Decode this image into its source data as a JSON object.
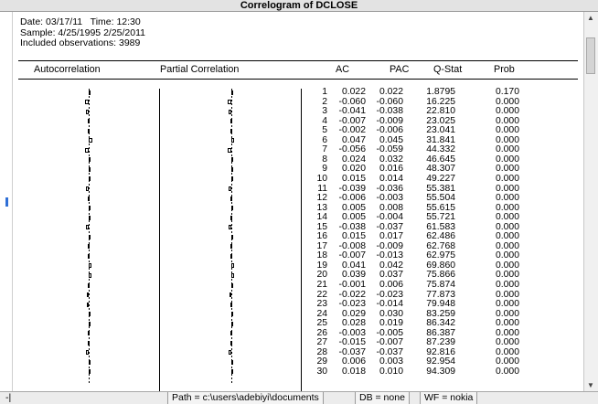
{
  "window": {
    "title": "Correlogram of DCLOSE"
  },
  "info": {
    "date_line": "Date: 03/17/11   Time: 12:30",
    "sample_line": "Sample: 4/25/1995 2/25/2011",
    "obs_line": "Included observations: 3989"
  },
  "headers": {
    "autocorrelation": "Autocorrelation",
    "partial_correlation": "Partial Correlation",
    "ac": "AC",
    "pac": "PAC",
    "qstat": "Q-Stat",
    "prob": "Prob"
  },
  "rows": [
    {
      "lag": "1",
      "ac": "0.022",
      "pac": "0.022",
      "q": "1.8795",
      "prob": "0.170"
    },
    {
      "lag": "2",
      "ac": "-0.060",
      "pac": "-0.060",
      "q": "16.225",
      "prob": "0.000"
    },
    {
      "lag": "3",
      "ac": "-0.041",
      "pac": "-0.038",
      "q": "22.810",
      "prob": "0.000"
    },
    {
      "lag": "4",
      "ac": "-0.007",
      "pac": "-0.009",
      "q": "23.025",
      "prob": "0.000"
    },
    {
      "lag": "5",
      "ac": "-0.002",
      "pac": "-0.006",
      "q": "23.041",
      "prob": "0.000"
    },
    {
      "lag": "6",
      "ac": "0.047",
      "pac": "0.045",
      "q": "31.841",
      "prob": "0.000"
    },
    {
      "lag": "7",
      "ac": "-0.056",
      "pac": "-0.059",
      "q": "44.332",
      "prob": "0.000"
    },
    {
      "lag": "8",
      "ac": "0.024",
      "pac": "0.032",
      "q": "46.645",
      "prob": "0.000"
    },
    {
      "lag": "9",
      "ac": "0.020",
      "pac": "0.016",
      "q": "48.307",
      "prob": "0.000"
    },
    {
      "lag": "10",
      "ac": "0.015",
      "pac": "0.014",
      "q": "49.227",
      "prob": "0.000"
    },
    {
      "lag": "11",
      "ac": "-0.039",
      "pac": "-0.036",
      "q": "55.381",
      "prob": "0.000"
    },
    {
      "lag": "12",
      "ac": "-0.006",
      "pac": "-0.003",
      "q": "55.504",
      "prob": "0.000"
    },
    {
      "lag": "13",
      "ac": "0.005",
      "pac": "0.008",
      "q": "55.615",
      "prob": "0.000"
    },
    {
      "lag": "14",
      "ac": "0.005",
      "pac": "-0.004",
      "q": "55.721",
      "prob": "0.000"
    },
    {
      "lag": "15",
      "ac": "-0.038",
      "pac": "-0.037",
      "q": "61.583",
      "prob": "0.000"
    },
    {
      "lag": "16",
      "ac": "0.015",
      "pac": "0.017",
      "q": "62.486",
      "prob": "0.000"
    },
    {
      "lag": "17",
      "ac": "-0.008",
      "pac": "-0.009",
      "q": "62.768",
      "prob": "0.000"
    },
    {
      "lag": "18",
      "ac": "-0.007",
      "pac": "-0.013",
      "q": "62.975",
      "prob": "0.000"
    },
    {
      "lag": "19",
      "ac": "0.041",
      "pac": "0.042",
      "q": "69.860",
      "prob": "0.000"
    },
    {
      "lag": "20",
      "ac": "0.039",
      "pac": "0.037",
      "q": "75.866",
      "prob": "0.000"
    },
    {
      "lag": "21",
      "ac": "-0.001",
      "pac": "0.006",
      "q": "75.874",
      "prob": "0.000"
    },
    {
      "lag": "22",
      "ac": "-0.022",
      "pac": "-0.023",
      "q": "77.873",
      "prob": "0.000"
    },
    {
      "lag": "23",
      "ac": "-0.023",
      "pac": "-0.014",
      "q": "79.948",
      "prob": "0.000"
    },
    {
      "lag": "24",
      "ac": "0.029",
      "pac": "0.030",
      "q": "83.259",
      "prob": "0.000"
    },
    {
      "lag": "25",
      "ac": "0.028",
      "pac": "0.019",
      "q": "86.342",
      "prob": "0.000"
    },
    {
      "lag": "26",
      "ac": "-0.003",
      "pac": "-0.005",
      "q": "86.387",
      "prob": "0.000"
    },
    {
      "lag": "27",
      "ac": "-0.015",
      "pac": "-0.007",
      "q": "87.239",
      "prob": "0.000"
    },
    {
      "lag": "28",
      "ac": "-0.037",
      "pac": "-0.037",
      "q": "92.816",
      "prob": "0.000"
    },
    {
      "lag": "29",
      "ac": "0.006",
      "pac": "0.003",
      "q": "92.954",
      "prob": "0.000"
    },
    {
      "lag": "30",
      "ac": "0.018",
      "pac": "0.010",
      "q": "94.309",
      "prob": "0.000"
    }
  ],
  "status": {
    "left": "-|",
    "path": "Path = c:\\users\\adebiyi\\documents",
    "db": "DB = none",
    "wf": "WF = nokia"
  },
  "icons": {
    "up": "scroll-up-arrow-icon",
    "down": "scroll-down-arrow-icon"
  }
}
